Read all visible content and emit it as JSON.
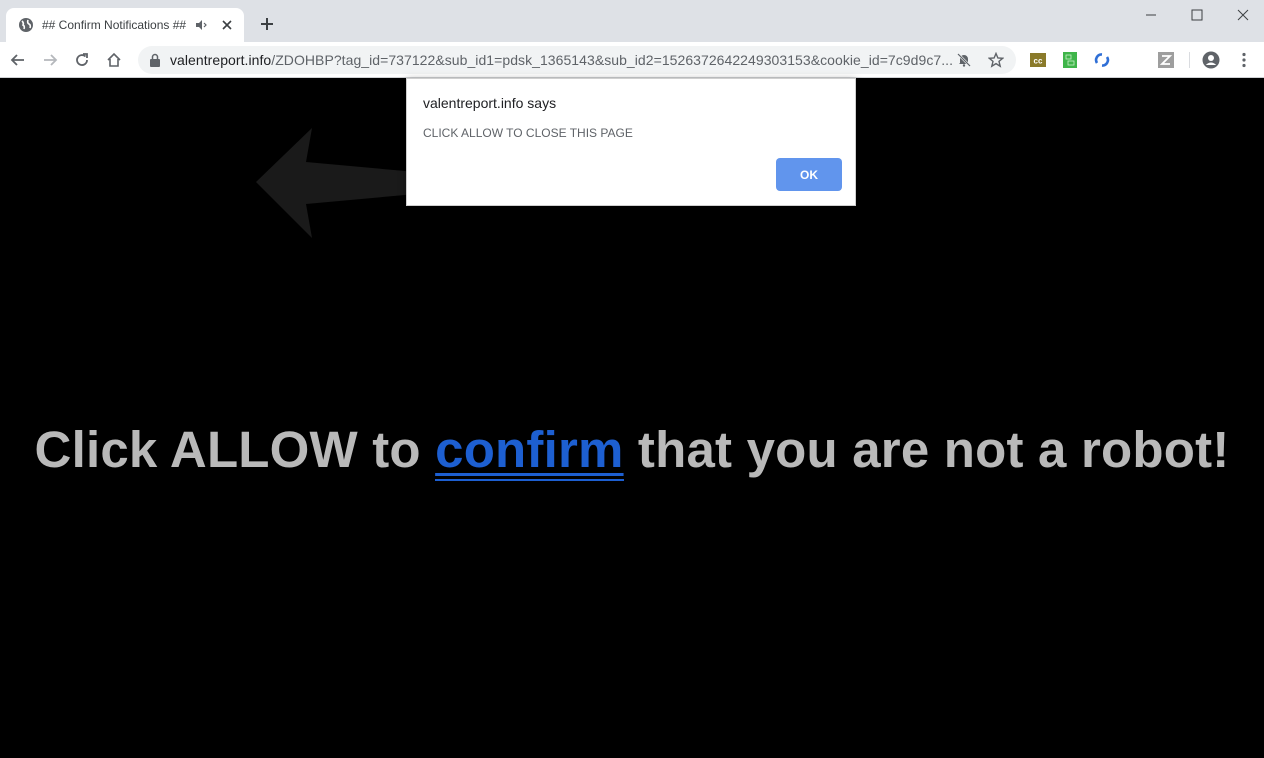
{
  "browser": {
    "tab": {
      "title": "## Confirm Notifications ##",
      "favicon": "globe-icon",
      "audio_icon": "speaker-muted-icon",
      "close_icon": "close-icon"
    },
    "new_tab_icon": "plus-icon",
    "window_controls": [
      "minimize-icon",
      "maximize-icon",
      "close-icon"
    ],
    "toolbar": {
      "back_icon": "arrow-left-icon",
      "forward_icon": "arrow-right-icon",
      "reload_icon": "reload-icon",
      "home_icon": "home-icon"
    },
    "omnibox": {
      "lock_icon": "lock-icon",
      "url_host": "valentreport.info",
      "url_rest": "/ZDOHBP?tag_id=737122&sub_id1=pdsk_1365143&sub_id2=1526372642249303153&cookie_id=7c9d9c7...",
      "notifications_blocked_icon": "bell-off-icon",
      "bookmark_icon": "star-icon"
    },
    "extensions": [
      {
        "name": "cc-extension-icon",
        "label": "cc",
        "color": "#8a7a2a"
      },
      {
        "name": "green-extension-icon",
        "label": "",
        "color": "#3fb54a"
      },
      {
        "name": "sync-extension-icon",
        "label": "",
        "color": "#2f6fd6"
      },
      {
        "name": "z-extension-icon",
        "label": "Z",
        "color": "#9e9e9e"
      }
    ],
    "profile_icon": "account-circle-icon",
    "menu_icon": "more-vert-icon"
  },
  "page": {
    "headline_before": "Click ALLOW to ",
    "headline_link": "confirm",
    "headline_after": " that you are not a robot!",
    "text_color": "#b9b9b9",
    "link_color": "#1d5fd1",
    "background": "#000000",
    "arrow_icon": "arrow-left-icon"
  },
  "dialog": {
    "origin": "valentreport.info says",
    "message": "CLICK ALLOW TO CLOSE THIS PAGE",
    "ok_label": "OK",
    "ok_color": "#6195ed"
  }
}
